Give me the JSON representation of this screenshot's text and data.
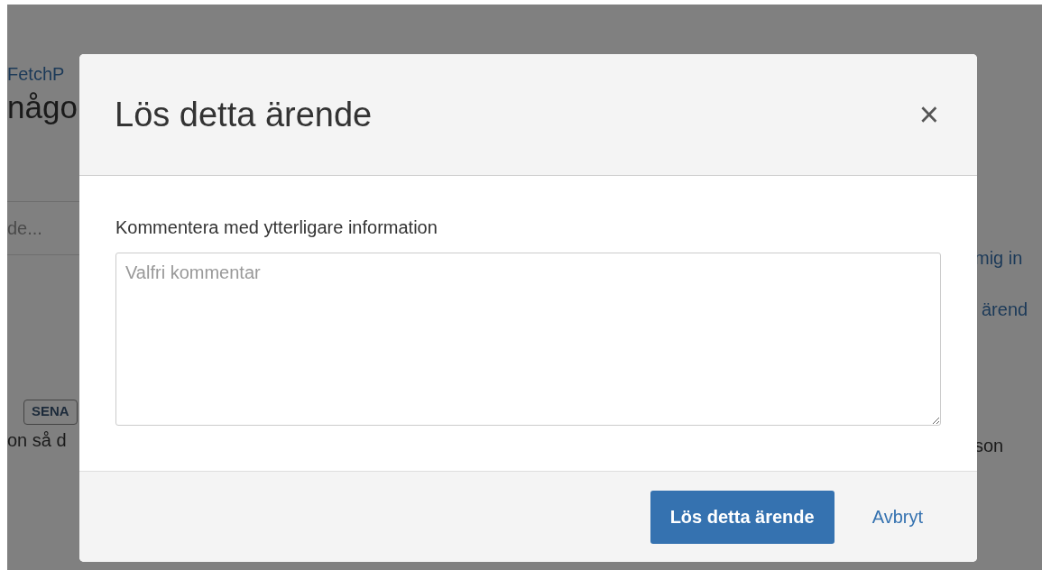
{
  "background_page": {
    "left": [
      {
        "kind": "link",
        "text": "FetchP"
      },
      {
        "kind": "heading",
        "text": "någo"
      },
      {
        "kind": "field",
        "placeholder": "de..."
      },
      {
        "kind": "badge",
        "text": "SENA"
      },
      {
        "kind": "text",
        "text": "on så d"
      }
    ],
    "right": [
      {
        "kind": "link",
        "text": "mig in"
      },
      {
        "kind": "link",
        "text": "ärend"
      },
      {
        "kind": "text",
        "text": "son"
      }
    ]
  },
  "dialog": {
    "title": "Lös detta ärende",
    "close": "×",
    "comment_label": "Kommentera med ytterligare information",
    "comment_field": {
      "placeholder": "Valfri kommentar"
    },
    "buttons": [
      {
        "kind": "primary",
        "label": "Lös detta ärende"
      },
      {
        "kind": "link",
        "label": "Avbryt"
      }
    ]
  }
}
